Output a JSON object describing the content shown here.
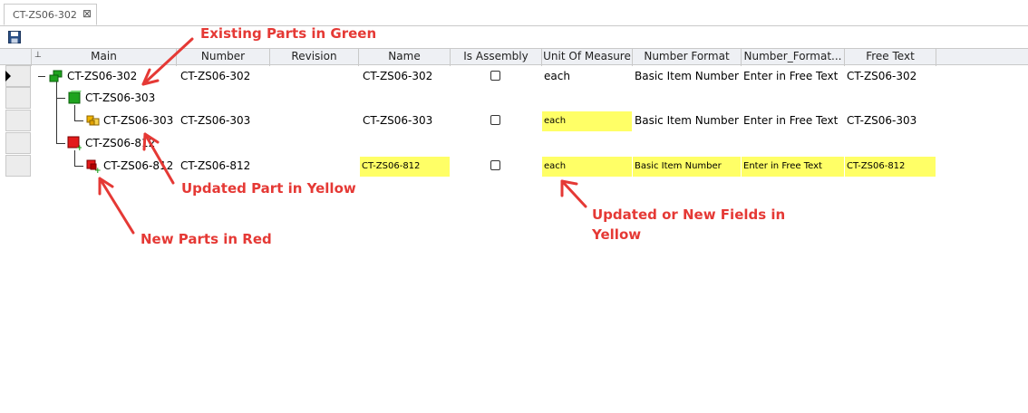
{
  "tab": {
    "title": "CT-ZS06-302",
    "close": "⊠"
  },
  "toolbar": {
    "save_icon": "save-icon"
  },
  "columns": [
    "Main",
    "Number",
    "Revision",
    "Name",
    "Is Assembly",
    "Unit Of Measure",
    "Number Format",
    "Number_Format...",
    "Free Text"
  ],
  "pin_icon": "pin-icon",
  "rows": [
    {
      "main": "CT-ZS06-302",
      "number": "CT-ZS06-302",
      "name": "CT-ZS06-302",
      "unit": "each",
      "numformat": "Basic Item Number",
      "numformat2": "Enter in Free Text",
      "freetext": "CT-ZS06-302"
    },
    {
      "main": "CT-ZS06-303"
    },
    {
      "main": "CT-ZS06-303",
      "number": "CT-ZS06-303",
      "name": "CT-ZS06-303",
      "unit": "each",
      "numformat": "Basic Item Number",
      "numformat2": "Enter in Free Text",
      "freetext": "CT-ZS06-303"
    },
    {
      "main": "CT-ZS06-812"
    },
    {
      "main": "CT-ZS06-812",
      "number": "CT-ZS06-812",
      "name": "CT-ZS06-812",
      "unit": "each",
      "numformat": "Basic Item Number",
      "numformat2": "Enter in Free Text",
      "freetext": "CT-ZS06-812"
    }
  ],
  "annotations": {
    "existing": "Existing Parts in Green",
    "updated_part": "Updated Part in Yellow",
    "new_parts": "New Parts in Red",
    "fields_line1": "Updated or New Fields in",
    "fields_line2": "Yellow"
  },
  "colors": {
    "existing": "#1fa31f",
    "new": "#e31a1a",
    "updated": "#ffff66",
    "annotation": "#e53935"
  }
}
